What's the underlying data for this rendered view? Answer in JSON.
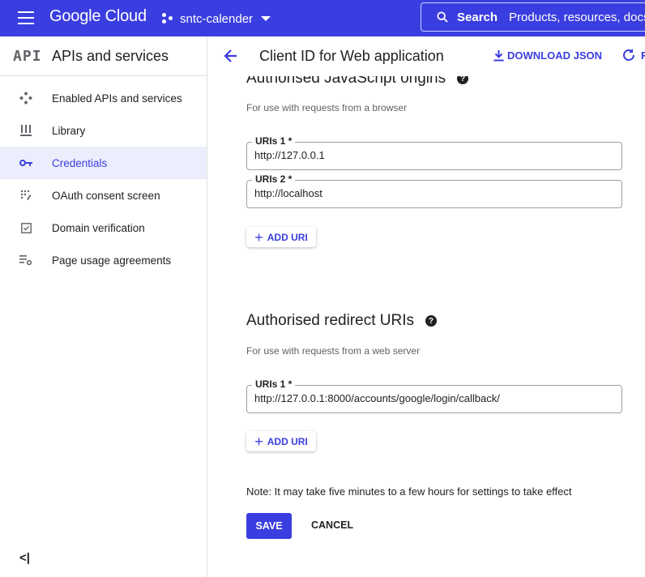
{
  "topbar": {
    "logo": "Google Cloud",
    "project": "sntc-calender",
    "search_label": "Search",
    "search_placeholder": "Products, resources, docs"
  },
  "sidebar": {
    "badge": "API",
    "title": "APIs and services",
    "items": [
      {
        "label": "Enabled APIs and services",
        "icon": "enabled-apis-icon"
      },
      {
        "label": "Library",
        "icon": "library-icon"
      },
      {
        "label": "Credentials",
        "icon": "key-icon",
        "active": true
      },
      {
        "label": "OAuth consent screen",
        "icon": "oauth-consent-icon"
      },
      {
        "label": "Domain verification",
        "icon": "domain-check-icon"
      },
      {
        "label": "Page usage agreements",
        "icon": "settings-list-icon"
      }
    ],
    "collapse": "<|"
  },
  "header": {
    "title": "Client ID for Web application",
    "download_json": "DOWNLOAD JSON",
    "refresh_label": "R"
  },
  "js_origins": {
    "title": "Authorised JavaScript origins",
    "subtitle": "For use with requests from a browser",
    "uris": [
      {
        "label": "URIs 1 *",
        "value": "http://127.0.0.1"
      },
      {
        "label": "URIs 2 *",
        "value": "http://localhost"
      }
    ],
    "add_label": "ADD URI"
  },
  "redirects": {
    "title": "Authorised redirect URIs",
    "subtitle": "For use with requests from a web server",
    "uris": [
      {
        "label": "URIs 1 *",
        "value": "http://127.0.0.1:8000/accounts/google/login/callback/"
      }
    ],
    "add_label": "ADD URI"
  },
  "note": "Note: It may take five minutes to a few hours for settings to take effect",
  "actions": {
    "save": "SAVE",
    "cancel": "CANCEL"
  },
  "colors": {
    "accent": "#3a3ee0",
    "active_bg": "#eceefd"
  }
}
